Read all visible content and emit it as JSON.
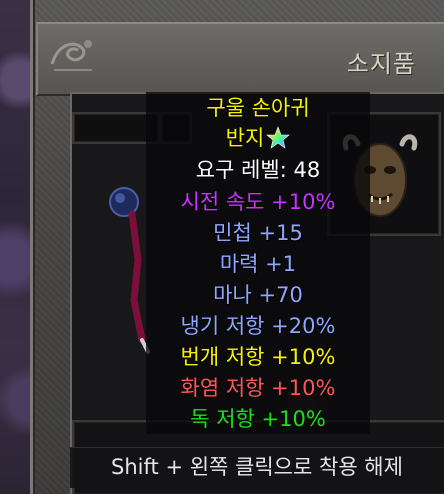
{
  "panel": {
    "title": "소지품"
  },
  "tooltip": {
    "item_name": "구울 손아귀",
    "item_type": "반지",
    "requirement": "요구 레벨: 48",
    "stats": [
      {
        "text": "시전 속도 +10%",
        "color": "#c733ff"
      },
      {
        "text": "민첩 +15",
        "color": "#8fa6ff"
      },
      {
        "text": "마력 +1",
        "color": "#8fa6ff"
      },
      {
        "text": "마나 +70",
        "color": "#8fa6ff"
      },
      {
        "text": "냉기 저항 +20%",
        "color": "#8fa6ff"
      },
      {
        "text": "번개 저항 +10%",
        "color": "#f6f200"
      },
      {
        "text": "화염 저항 +10%",
        "color": "#ff5555"
      },
      {
        "text": "독 저항 +10%",
        "color": "#19e219"
      }
    ],
    "name_color": "#f6f200",
    "requirement_color": "#ffffff",
    "rarity_icon": "rainbow-star-icon"
  },
  "hint": {
    "text": "Shift + 왼쪽 클릭으로 착용 해제"
  }
}
